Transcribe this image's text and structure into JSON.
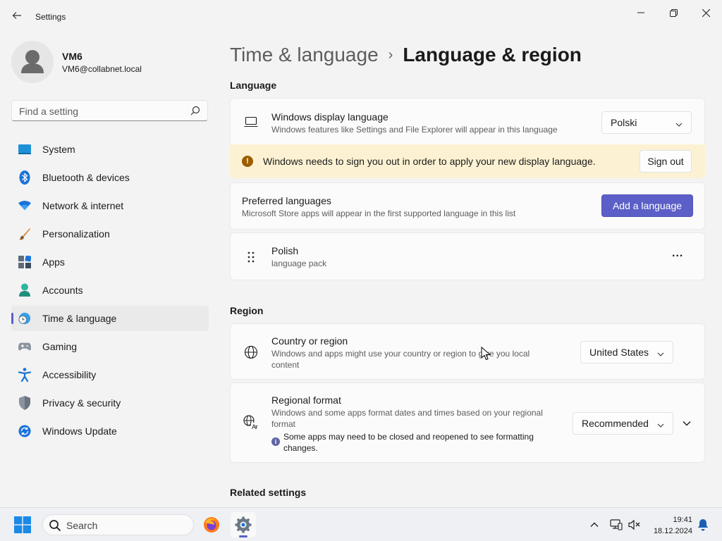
{
  "window": {
    "title": "Settings"
  },
  "user": {
    "name": "VM6",
    "email": "VM6@collabnet.local"
  },
  "search": {
    "placeholder": "Find a setting"
  },
  "sidebar": {
    "items": [
      {
        "label": "System",
        "icon": "system-icon"
      },
      {
        "label": "Bluetooth & devices",
        "icon": "bluetooth-icon"
      },
      {
        "label": "Network & internet",
        "icon": "wifi-icon"
      },
      {
        "label": "Personalization",
        "icon": "brush-icon"
      },
      {
        "label": "Apps",
        "icon": "apps-icon"
      },
      {
        "label": "Accounts",
        "icon": "accounts-icon"
      },
      {
        "label": "Time & language",
        "icon": "globe-clock-icon",
        "active": true
      },
      {
        "label": "Gaming",
        "icon": "gamepad-icon"
      },
      {
        "label": "Accessibility",
        "icon": "accessibility-icon"
      },
      {
        "label": "Privacy & security",
        "icon": "shield-icon"
      },
      {
        "label": "Windows Update",
        "icon": "update-icon"
      }
    ]
  },
  "breadcrumb": {
    "parent": "Time & language",
    "separator": "›",
    "current": "Language & region"
  },
  "language": {
    "heading": "Language",
    "display": {
      "title": "Windows display language",
      "desc": "Windows features like Settings and File Explorer will appear in this language",
      "value": "Polski"
    },
    "warning": {
      "text": "Windows needs to sign you out in order to apply your new display language.",
      "button": "Sign out"
    },
    "preferred": {
      "title": "Preferred languages",
      "desc": "Microsoft Store apps will appear in the first supported language in this list",
      "button": "Add a language"
    },
    "pack": {
      "title": "Polish",
      "desc": "language pack",
      "more": "..."
    }
  },
  "region": {
    "heading": "Region",
    "country": {
      "title": "Country or region",
      "desc_line1": "Windows and apps might use your country or region to give you local",
      "desc_line2": "content",
      "value": "United States"
    },
    "format": {
      "title": "Regional format",
      "desc_line1": "Windows and some apps format dates and times based on your regional",
      "desc_line2": "format",
      "note_line1": "Some apps may need to be closed and reopened to see formatting",
      "note_line2": "changes.",
      "value": "Recommended"
    }
  },
  "related": {
    "heading": "Related settings"
  },
  "taskbar": {
    "search_placeholder": "Search",
    "time": "19:41",
    "date": "18.12.2024"
  },
  "colors": {
    "accent": "#5b5fc7",
    "warning_bg": "#fcf2d3",
    "warning_icon": "#9d5d00"
  }
}
